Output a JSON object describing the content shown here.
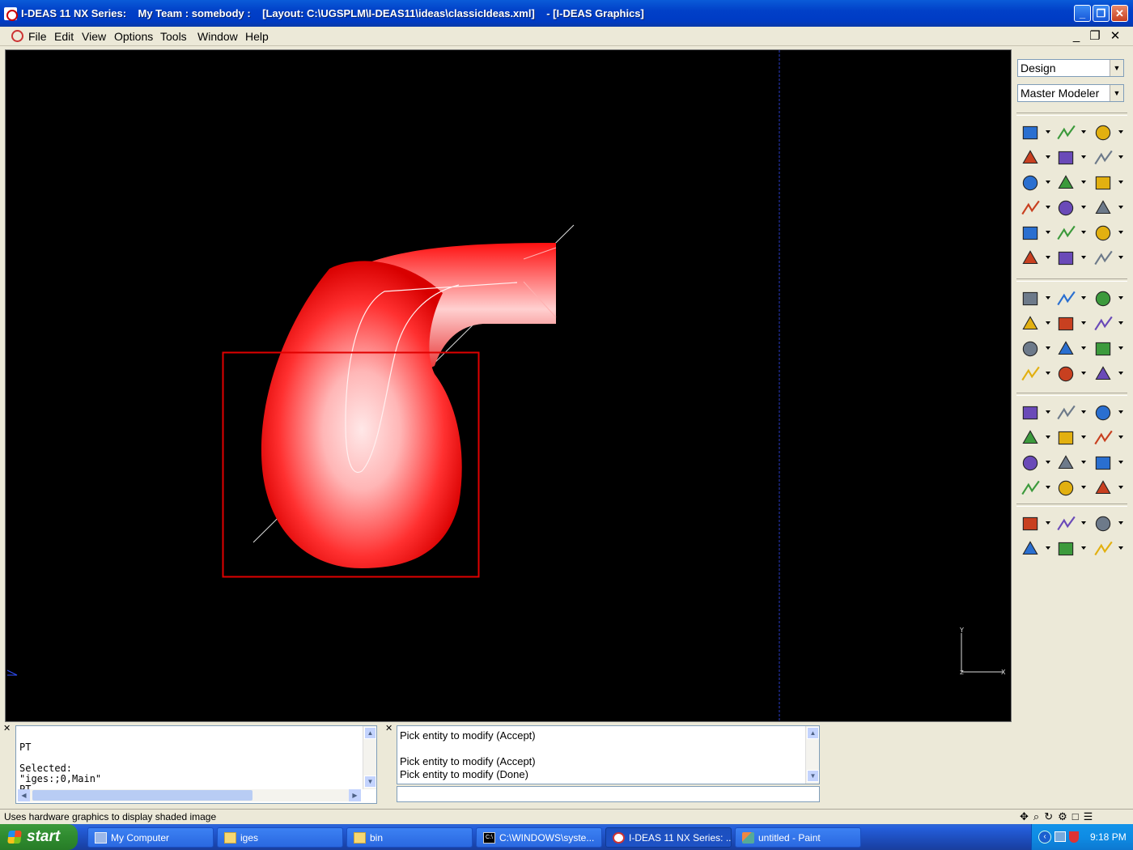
{
  "window": {
    "title": "I-DEAS 11 NX Series:    My Team : somebody :    [Layout: C:\\UGSPLM\\I-DEAS11\\ideas\\classicIdeas.xml]    - [I-DEAS Graphics]",
    "minimize_label": "_",
    "maximize_label": "❐",
    "close_label": "✕"
  },
  "menubar": {
    "items": [
      "File",
      "Edit",
      "View",
      "Options",
      "Tools",
      "Window",
      "Help"
    ],
    "mdi_minimize": "_",
    "mdi_restore": "❐",
    "mdi_close": "✕"
  },
  "right_panel": {
    "task_combo": "Design",
    "application_combo": "Master Modeler",
    "toolbar_groups": [
      [
        "block-icon",
        "workplane-icon",
        "arch-icon",
        "polyline-icon",
        "fillet-curve-icon",
        "plane-icon",
        "circle-icon",
        "spline-icon",
        "offset-curve-icon",
        "dimension-icon",
        "trim-icon",
        "sketch-icon",
        "extrude-icon",
        "cube-icon",
        "boolean-icon",
        "rectangle-icon",
        "surface-icon",
        "partition-icon"
      ],
      [
        "tree-icon",
        "select-icon",
        "modify-icon",
        "box-icon",
        "info-icon",
        "paint-icon",
        "forward-icon",
        "measure-icon",
        "store-icon",
        "eraser-icon",
        "list-icon",
        "datum-icon"
      ],
      [
        "display-icon",
        "wireframe-icon",
        "shaded-icon",
        "zoom-all-icon",
        "zoom-box-icon",
        "view-icon",
        "front-view-icon",
        "iso-view-icon",
        "circle-view-icon",
        "side-view-icon",
        "top-view-icon",
        "print-icon"
      ],
      [
        "ruler-icon",
        "curve-measure-icon",
        "angle-icon",
        "radius-icon",
        "section-icon",
        "xyz-icon"
      ]
    ]
  },
  "viewport": {
    "triad_labels": {
      "y": "Y",
      "x": "X",
      "z": "Z"
    }
  },
  "list_window": {
    "lines": [
      "PT",
      "",
      "Selected:",
      "\"iges:;0,Main\"",
      "PT"
    ]
  },
  "prompt_window": {
    "lines": [
      "Pick entity to modify (Accept)",
      "",
      "Pick entity to modify (Accept)",
      "Pick entity to modify (Done)"
    ],
    "input_value": ""
  },
  "statusbar": {
    "message": "Uses hardware graphics to display shaded image"
  },
  "taskbar": {
    "start_label": "start",
    "tasks": [
      {
        "label": "My Computer",
        "active": false
      },
      {
        "label": "iges",
        "active": false
      },
      {
        "label": "bin",
        "active": false
      },
      {
        "label": "C:\\WINDOWS\\syste...",
        "active": false
      },
      {
        "label": "I-DEAS 11 NX Series: ...",
        "active": true
      },
      {
        "label": "untitled - Paint",
        "active": false
      }
    ],
    "clock": "9:18 PM"
  },
  "colors": {
    "titlebar": "#0a5bd8",
    "viewport_bg": "#000000",
    "model_red": "#ff1a1a",
    "box_outline": "#e00000",
    "taskbar": "#245edb",
    "start_green": "#2f8b2f"
  }
}
